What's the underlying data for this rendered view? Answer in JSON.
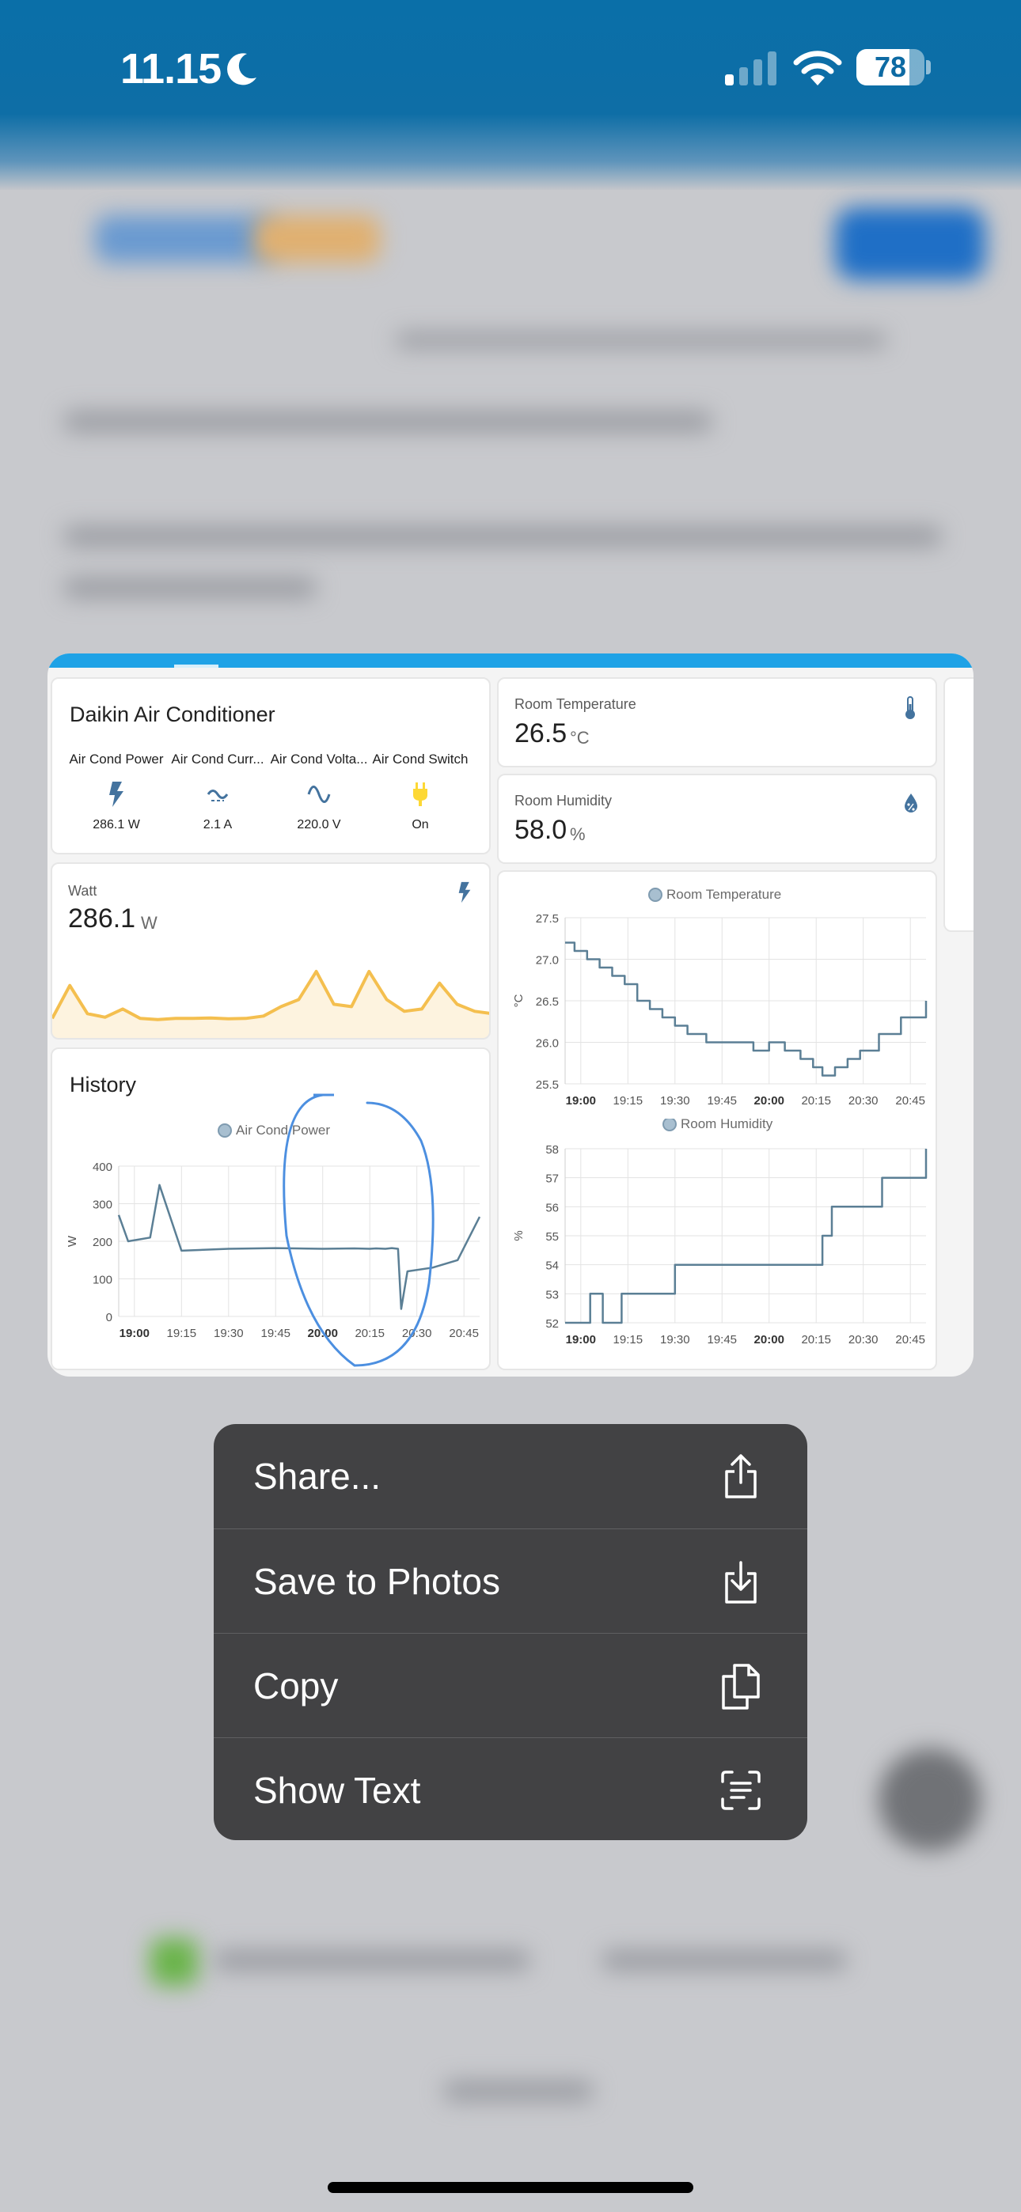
{
  "status_bar": {
    "time": "11.15",
    "battery_percent": "78",
    "battery_level": 0.78
  },
  "preview": {
    "aircon_card": {
      "title": "Daikin Air Conditioner",
      "entities": [
        {
          "name": "Air Cond Power",
          "value": "286.1 W",
          "icon": "flash-icon"
        },
        {
          "name": "Air Cond Curr...",
          "value": "2.1 A",
          "icon": "current-ac-icon"
        },
        {
          "name": "Air Cond Volta...",
          "value": "220.0 V",
          "icon": "sine-wave-icon"
        },
        {
          "name": "Air Cond Switch",
          "value": "On",
          "icon": "power-plug-icon"
        }
      ]
    },
    "watt_card": {
      "label": "Watt",
      "value": "286.1",
      "unit": "W",
      "icon": "flash-icon"
    },
    "temperature_card": {
      "label": "Room Temperature",
      "value": "26.5",
      "unit": "°C",
      "icon": "thermometer-icon"
    },
    "humidity_card": {
      "label": "Room Humidity",
      "value": "58.0",
      "unit": "%",
      "icon": "water-percent-icon"
    },
    "history_card": {
      "title": "History"
    }
  },
  "chart_data": [
    {
      "type": "area",
      "title": "",
      "x": [
        "18:50",
        "18:55",
        "19:00",
        "19:05",
        "19:10",
        "19:15",
        "19:20",
        "19:25",
        "19:30",
        "19:35",
        "19:40",
        "19:45",
        "19:50",
        "19:55",
        "20:00",
        "20:05",
        "20:10",
        "20:15",
        "20:20",
        "20:25",
        "20:30",
        "20:35",
        "20:40",
        "20:45",
        "20:50",
        "20:55"
      ],
      "values": [
        180,
        320,
        200,
        185,
        220,
        180,
        175,
        180,
        180,
        182,
        178,
        180,
        190,
        230,
        260,
        380,
        240,
        230,
        380,
        260,
        210,
        220,
        330,
        240,
        210,
        200
      ],
      "color": "#f4bf4f"
    },
    {
      "type": "line",
      "series": [
        {
          "name": "Air Cond Power",
          "values": [
            270,
            200,
            210,
            350,
            175,
            180,
            182,
            180,
            181,
            180,
            181,
            180,
            182,
            180,
            20,
            120,
            130,
            150,
            265
          ]
        }
      ],
      "x": [
        "18:55",
        "18:58",
        "19:05",
        "19:08",
        "19:15",
        "19:30",
        "19:45",
        "20:00",
        "20:10",
        "20:15",
        "20:17",
        "20:20",
        "20:22",
        "20:24",
        "20:25",
        "20:27",
        "20:35",
        "20:43",
        "20:50"
      ],
      "ylabel": "W",
      "ylim": [
        0,
        400
      ],
      "yticks": [
        "0",
        "100",
        "200",
        "300",
        "400"
      ],
      "xticks": [
        "19:00",
        "19:15",
        "19:30",
        "19:45",
        "20:00",
        "20:15",
        "20:30",
        "20:45"
      ],
      "color": "#5b7f95"
    },
    {
      "type": "line",
      "series": [
        {
          "name": "Room Temperature",
          "values": [
            27.2,
            27.1,
            27.0,
            26.9,
            26.8,
            26.7,
            26.5,
            26.4,
            26.3,
            26.2,
            26.1,
            26.0,
            26.0,
            25.9,
            26.0,
            25.9,
            25.8,
            25.7,
            25.6,
            25.7,
            25.8,
            25.9,
            26.1,
            26.3,
            26.5
          ]
        }
      ],
      "x": [
        "18:55",
        "18:58",
        "19:02",
        "19:06",
        "19:10",
        "19:14",
        "19:18",
        "19:22",
        "19:26",
        "19:30",
        "19:34",
        "19:40",
        "19:50",
        "19:55",
        "20:00",
        "20:05",
        "20:10",
        "20:14",
        "20:17",
        "20:21",
        "20:25",
        "20:29",
        "20:35",
        "20:42",
        "20:50"
      ],
      "ylabel": "°C",
      "ylim": [
        25.5,
        27.5
      ],
      "yticks": [
        "25.5",
        "26.0",
        "26.5",
        "27.0",
        "27.5"
      ],
      "xticks": [
        "19:00",
        "19:15",
        "19:30",
        "19:45",
        "20:00",
        "20:15",
        "20:30",
        "20:45"
      ],
      "color": "#5b7f95"
    },
    {
      "type": "line",
      "series": [
        {
          "name": "Room Humidity",
          "values": [
            52,
            53,
            52,
            53,
            54,
            54,
            55,
            56,
            57,
            58
          ]
        }
      ],
      "x": [
        "18:55",
        "19:03",
        "19:07",
        "19:13",
        "19:30",
        "20:10",
        "20:17",
        "20:20",
        "20:36",
        "20:50"
      ],
      "ylabel": "%",
      "ylim": [
        52,
        58
      ],
      "yticks": [
        "52",
        "53",
        "54",
        "55",
        "56",
        "57",
        "58"
      ],
      "xticks": [
        "19:00",
        "19:15",
        "19:30",
        "19:45",
        "20:00",
        "20:15",
        "20:30",
        "20:45"
      ],
      "color": "#5b7f95"
    }
  ],
  "menu": {
    "items": [
      {
        "label": "Share...",
        "icon": "share-icon"
      },
      {
        "label": "Save to Photos",
        "icon": "save-to-photos-icon"
      },
      {
        "label": "Copy",
        "icon": "copy-icon"
      },
      {
        "label": "Show Text",
        "icon": "show-text-icon"
      }
    ]
  }
}
